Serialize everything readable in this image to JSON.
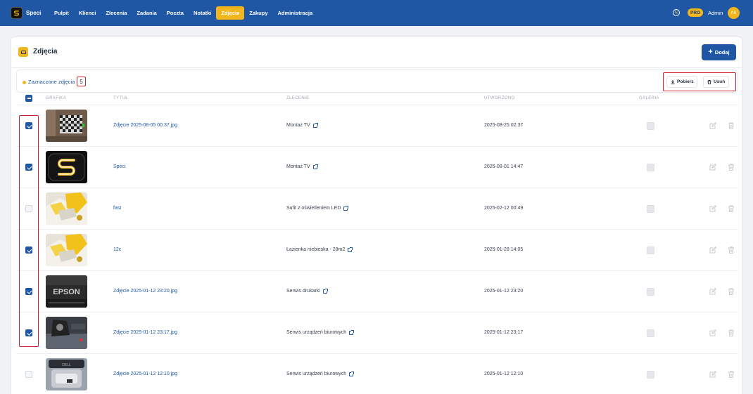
{
  "brand": "Speci",
  "nav": [
    {
      "label": "Pulpit",
      "active": false
    },
    {
      "label": "Klienci",
      "active": false
    },
    {
      "label": "Zlecenia",
      "active": false
    },
    {
      "label": "Zadania",
      "active": false
    },
    {
      "label": "Poczta",
      "active": false
    },
    {
      "label": "Notatki",
      "active": false
    },
    {
      "label": "Zdjęcia",
      "active": true
    },
    {
      "label": "Zakupy",
      "active": false
    },
    {
      "label": "Administracja",
      "active": false
    }
  ],
  "user": {
    "badge": "PRO",
    "name": "Admin",
    "initials": "AS"
  },
  "page": {
    "title": "Zdjęcia",
    "add_label": "Dodaj"
  },
  "selection": {
    "label": "Zaznaczone zdjęcia",
    "count": "5",
    "download_label": "Pobierz",
    "delete_label": "Usuń"
  },
  "columns": {
    "image": "GRAFIKA",
    "title": "TYTUŁ",
    "order": "ZLECENIE",
    "created": "UTWORZONO",
    "gallery": "GALERIA"
  },
  "rows": [
    {
      "checked": true,
      "title": "Zdjęcie 2025-08-05 00:37.jpg",
      "order": "Montaż TV",
      "created": "2025-08-25 02:37",
      "thumb": "checkerboard-wall"
    },
    {
      "checked": true,
      "title": "Speci",
      "order": "Montaż TV",
      "created": "2025-08-01 14:47",
      "thumb": "speci-logo"
    },
    {
      "checked": false,
      "title": "fast",
      "order": "Sufit z oświetleniem LED",
      "created": "2025-02-12 00:49",
      "thumb": "yellow-tool"
    },
    {
      "checked": true,
      "title": "12c",
      "order": "Łazienka niebieska - 28m2",
      "created": "2025-01-28 14:05",
      "thumb": "yellow-tool"
    },
    {
      "checked": true,
      "title": "Zdjęcie 2025-01-12 23:20.jpg",
      "order": "Serwis drukarki",
      "created": "2025-01-12 23:20",
      "thumb": "epson-printer"
    },
    {
      "checked": true,
      "title": "Zdjęcie 2025-01-12 23:17.jpg",
      "order": "Serwis urządzeń biurowych",
      "created": "2025-01-12 23:17",
      "thumb": "office-device"
    },
    {
      "checked": false,
      "title": "Zdjęcie 2025-01-12 12:10.jpg",
      "order": "Serwis urządzeń biurowych",
      "created": "2025-01-12 12:10",
      "thumb": "dell-device"
    }
  ],
  "colors": {
    "nav_bg": "#1f57a4",
    "accent": "#f2b51b",
    "highlight": "#d0202a"
  }
}
